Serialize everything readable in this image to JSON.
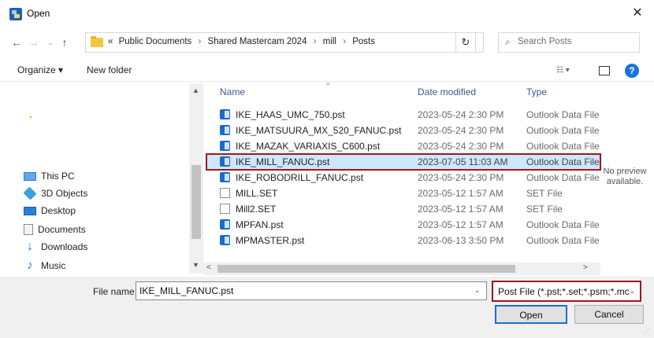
{
  "window": {
    "title": "Open",
    "close_glyph": "✕"
  },
  "nav_buttons": {
    "back": "←",
    "forward": "→",
    "recent": "⌄",
    "up": "↑"
  },
  "address": {
    "overflow": "«",
    "crumbs": [
      "Public Documents",
      "Shared Mastercam 2024",
      "mill",
      "Posts"
    ],
    "separator": "›",
    "dropdown": "⌄",
    "refresh": "↻"
  },
  "search": {
    "icon": "⌕",
    "placeholder": "Search Posts"
  },
  "toolbar": {
    "organize": "Organize ▾",
    "new_folder": "New folder",
    "view_icon": "☷ ▾",
    "help": "?"
  },
  "nav_pane": {
    "items": [
      {
        "label": "This PC",
        "icon": "computer-icon"
      },
      {
        "label": "3D Objects",
        "icon": "cube-icon"
      },
      {
        "label": "Desktop",
        "icon": "desktop-icon"
      },
      {
        "label": "Documents",
        "icon": "document-icon"
      },
      {
        "label": "Downloads",
        "icon": "download-arrow-icon"
      },
      {
        "label": "Music",
        "icon": "music-note-icon"
      }
    ],
    "scroll_up": "▲",
    "scroll_down": "▼"
  },
  "columns": {
    "name": "Name",
    "date": "Date modified",
    "type": "Type",
    "sort_glyph": "^"
  },
  "files": [
    {
      "name": "IKE_HAAS_UMC_750.pst",
      "date": "2023-05-24 2:30 PM",
      "type": "Outlook Data File",
      "icon": "pst"
    },
    {
      "name": "IKE_MATSUURA_MX_520_FANUC.pst",
      "date": "2023-05-24 2:30 PM",
      "type": "Outlook Data File",
      "icon": "pst"
    },
    {
      "name": "IKE_MAZAK_VARIAXIS_C600.pst",
      "date": "2023-05-24 2:30 PM",
      "type": "Outlook Data File",
      "icon": "pst"
    },
    {
      "name": "IKE_MILL_FANUC.pst",
      "date": "2023-07-05 11:03 AM",
      "type": "Outlook Data File",
      "icon": "pst",
      "selected": true
    },
    {
      "name": "IKE_ROBODRILL_FANUC.pst",
      "date": "2023-05-24 2:30 PM",
      "type": "Outlook Data File",
      "icon": "pst"
    },
    {
      "name": "MILL.SET",
      "date": "2023-05-12 1:57 AM",
      "type": "SET File",
      "icon": "set"
    },
    {
      "name": "Mill2.SET",
      "date": "2023-05-12 1:57 AM",
      "type": "SET File",
      "icon": "set"
    },
    {
      "name": "MPFAN.pst",
      "date": "2023-05-12 1:57 AM",
      "type": "Outlook Data File",
      "icon": "pst"
    },
    {
      "name": "MPMASTER.pst",
      "date": "2023-06-13 3:50 PM",
      "type": "Outlook Data File",
      "icon": "pst"
    }
  ],
  "preview": {
    "line1": "No preview",
    "line2": "available."
  },
  "hscroll": {
    "left": "<",
    "right": ">"
  },
  "bottom": {
    "file_name_label": "File name:",
    "file_name_value": "IKE_MILL_FANUC.pst",
    "file_name_dropdown": "⌄",
    "filter": "Post File (*.pst;*.set;*.psm;*.mc",
    "filter_dropdown": "⌄",
    "open": "Open",
    "cancel": "Cancel",
    "grip": "⋰"
  },
  "colors": {
    "selection": "#cce8ff",
    "highlight_border": "#a3151d",
    "accent": "#1a6fd1"
  }
}
